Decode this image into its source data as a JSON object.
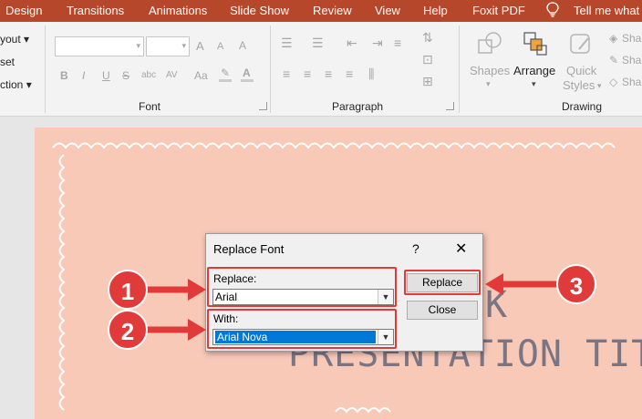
{
  "tabs": [
    "Design",
    "Transitions",
    "Animations",
    "Slide Show",
    "Review",
    "View",
    "Help",
    "Foxit PDF",
    "Tell me what"
  ],
  "ribbon": {
    "slides_group": {
      "layout": "yout",
      "reset": "set",
      "section": "ction"
    },
    "font_group_label": "Font",
    "paragraph_group_label": "Paragraph",
    "drawing_group_label": "Drawing",
    "shapes_label": "Shapes",
    "arrange_label": "Arrange",
    "quick_styles_label_1": "Quick",
    "quick_styles_label_2": "Styles",
    "shape_fill": "Sha",
    "shape_outline": "Sha",
    "shape_effects": "Sha",
    "font_buttons": [
      "B",
      "I",
      "U",
      "S",
      "abc",
      "AV",
      "Aa"
    ],
    "size_buttons": [
      "A",
      "A",
      "A"
    ]
  },
  "slide": {
    "title_line_1": "K",
    "title_line_2": "PRESENTATION TITLE"
  },
  "dialog": {
    "title": "Replace Font",
    "help": "?",
    "close": "✕",
    "replace_label": "Replace:",
    "replace_value": "Arial",
    "with_label": "With:",
    "with_value": "Arial Nova",
    "replace_button": "Replace",
    "close_button": "Close"
  },
  "callouts": [
    "1",
    "2",
    "3"
  ],
  "colors": {
    "accent": "#b7472a",
    "callout": "#e03a3a",
    "slide_bg": "#f9c9b8",
    "selection": "#0078d7"
  }
}
